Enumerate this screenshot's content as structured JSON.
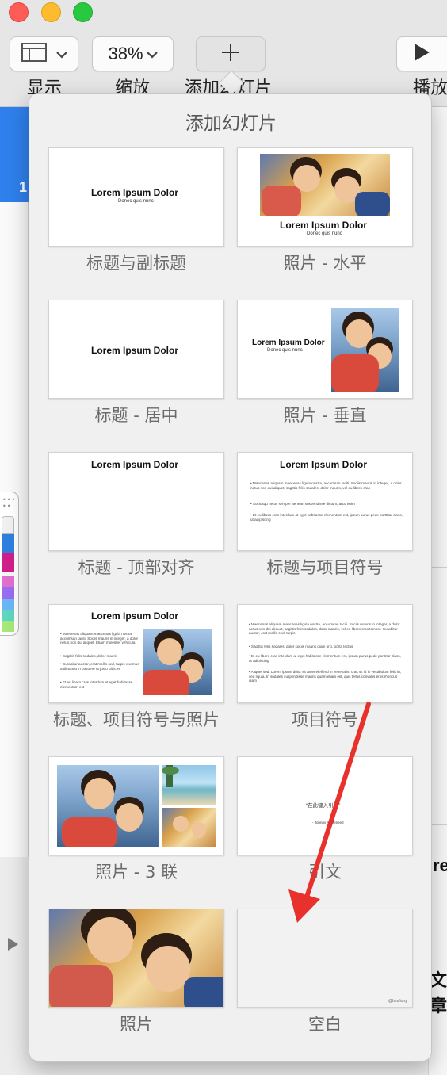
{
  "toolbar": {
    "view_label": "显示",
    "zoom_value": "38%",
    "zoom_label": "缩放",
    "add_slide_label": "添加幻灯片",
    "play_label": "播放"
  },
  "navigator": {
    "selected_slide_number": "1"
  },
  "popover": {
    "title": "添加幻灯片",
    "layouts": [
      {
        "name": "标题与副标题",
        "title": "Lorem Ipsum Dolor",
        "subtitle": "Donec quis nunc"
      },
      {
        "name": "照片 - 水平",
        "title": "Lorem Ipsum Dolor",
        "subtitle": "Donec quis nunc"
      },
      {
        "name": "标题 - 居中",
        "title": "Lorem Ipsum Dolor"
      },
      {
        "name": "照片 - 垂直",
        "title": "Lorem Ipsum Dolor",
        "subtitle": "Donec quis nunc"
      },
      {
        "name": "标题 - 顶部对齐",
        "title": "Lorem Ipsum Dolor"
      },
      {
        "name": "标题与项目符号",
        "title": "Lorem Ipsum Dolor",
        "bullets": [
          "Maecenas aliquam maecenas ligula nostra, accumsan taciti. Sociis mauris in integer, a dolor netus non dui aliquet, sagittis felis sodales, dolor mauris, vel eu libero cras",
          "Sociosqu netus semper aenean suspendisse dictum, arcu enim",
          "Et eu libero cras interdum at eget habitasse elementum est, ipsum purus pede porttitor class, ut adipiscing"
        ]
      },
      {
        "name": "标题、项目符号与照片",
        "title": "Lorem Ipsum Dolor",
        "bullets": [
          "Maecenas aliquam maecenas ligula nostra, accumsan taciti. Sociis mauris in integer, a dolor netus non dui aliquet. Etiam molestie, vehicula",
          "Sagittis felis sodales, dolor mauris",
          "Curabitur auctor, erat mollis sed, turpis vivamus a dictumst in posuere ut justo ultrices",
          "Et eu libero cras interdum at eget habitasse elementum est"
        ]
      },
      {
        "name": "项目符号",
        "bullets": [
          "Maecenas aliquam maecenas ligula nostra, accumsan taciti. Sociis mauris in integer, a dolor netus non dui aliquet, sagittis felis sodales, dolor mauris, vel eu libero cras tempor. Curabitur auctor, erat mollis sed, turpis",
          "Sagittis felis sodales, dolor sociis mauris diam orci, porta lectus",
          "Et eu libero cras interdum at eget habitasse elementum est, ipsum purus pede porttitor class, ut adipiscing",
          "Aliquet sed. Lorem ipsum dolor sit amet eleifend in venenatis, cras sit id in vestibulum felis in, sed ligula. In sodales suspendisse mauris quam etiam est, quis tellus convallis eros rhoncus diam"
        ]
      },
      {
        "name": "照片 - 3 联"
      },
      {
        "name": "引文",
        "quote": "“在此键入引文”",
        "attribution": "- Johnny Appleseed"
      },
      {
        "name": "照片"
      },
      {
        "name": "空白",
        "watermark": "@besfiony"
      }
    ]
  },
  "palette_colors": [
    "#f0f0f0",
    "#2f7fe0",
    "#d01f8a",
    "#f5f5f5",
    "#e070d0",
    "#9a6cf0",
    "#6ab6f5",
    "#5ed6c0",
    "#a6e87a"
  ],
  "right_snippets": {
    "top": "re",
    "bottom": "文章"
  },
  "annotation": {
    "color": "#e8312c"
  }
}
